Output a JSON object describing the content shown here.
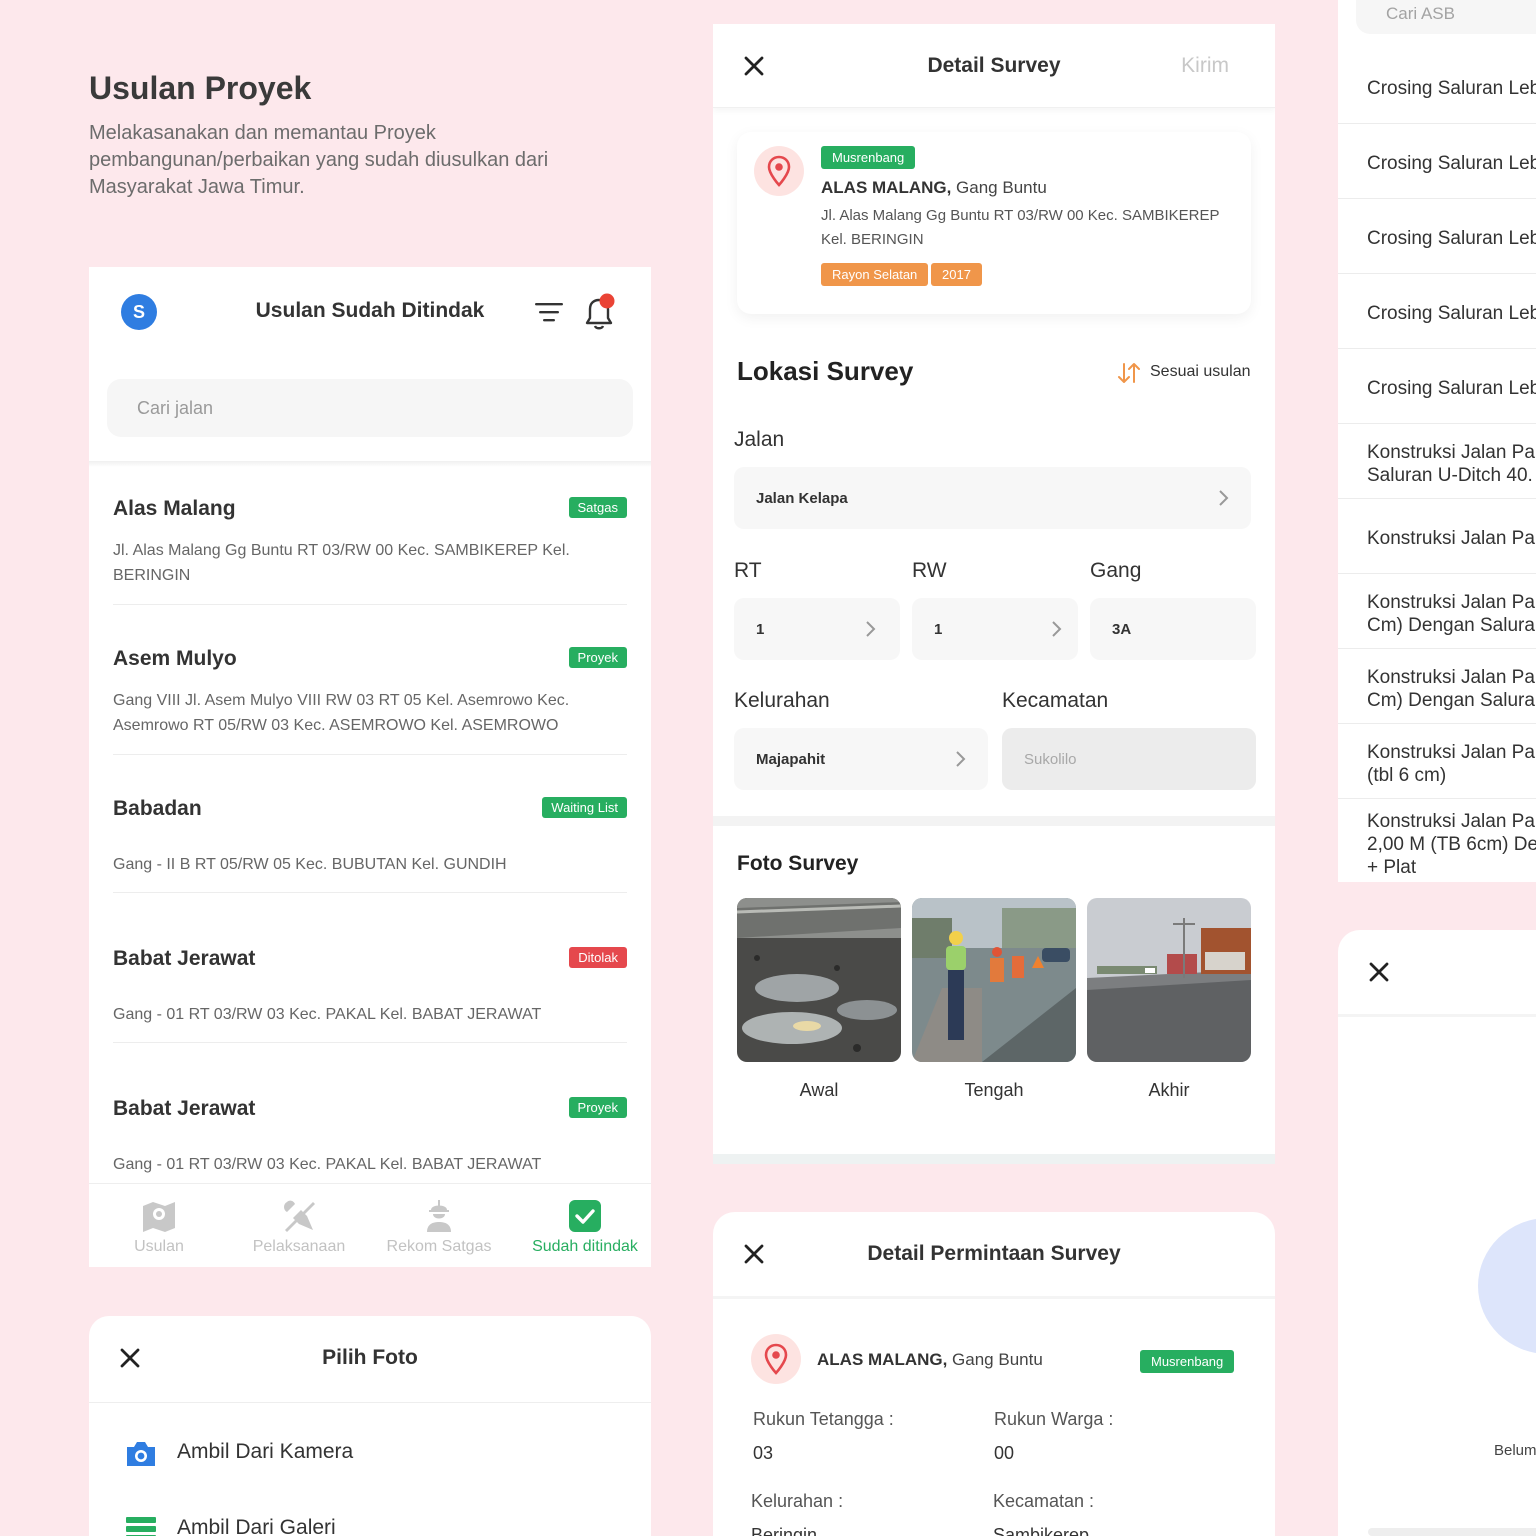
{
  "hero": {
    "title": "Usulan Proyek",
    "description": "Melakasanakan dan memantau Proyek pembangunan/perbaikan yang sudah diusulkan dari Masyarakat Jawa Timur."
  },
  "list_screen": {
    "avatar_letter": "S",
    "title": "Usulan Sudah Ditindak",
    "search_placeholder": "Cari jalan",
    "items": [
      {
        "name": "Alas Malang",
        "badge": "Satgas",
        "badge_color": "#27ae60",
        "address": "Jl. Alas Malang Gg Buntu RT 03/RW 00 Kec. SAMBIKEREP Kel. BERINGIN"
      },
      {
        "name": "Asem Mulyo",
        "badge": "Proyek",
        "badge_color": "#27ae60",
        "address": "Gang VIII Jl. Asem Mulyo VIII RW 03 RT 05 Kel. Asemrowo Kec. Asemrowo RT 05/RW 03 Kec. ASEMROWO Kel. ASEMROWO"
      },
      {
        "name": "Babadan",
        "badge": "Waiting List",
        "badge_color": "#27ae60",
        "address": "Gang - II B RT 05/RW 05 Kec. BUBUTAN Kel. GUNDIH"
      },
      {
        "name": "Babat Jerawat",
        "badge": "Ditolak",
        "badge_color": "#e5484d",
        "address": "Gang - 01 RT 03/RW 03 Kec. PAKAL Kel. BABAT JERAWAT"
      },
      {
        "name": "Babat Jerawat",
        "badge": "Proyek",
        "badge_color": "#27ae60",
        "address": "Gang - 01 RT 03/RW 03 Kec. PAKAL Kel. BABAT JERAWAT"
      }
    ],
    "nav": [
      {
        "label": "Usulan",
        "icon": "map-icon",
        "active": false
      },
      {
        "label": "Pelaksanaan",
        "icon": "tools-icon",
        "active": false
      },
      {
        "label": "Rekom Satgas",
        "icon": "worker-icon",
        "active": false
      },
      {
        "label": "Sudah ditindak",
        "icon": "check-icon",
        "active": true
      }
    ],
    "active_color": "#27ae60"
  },
  "photo_picker": {
    "title": "Pilih Foto",
    "options": [
      "Ambil Dari Kamera",
      "Ambil Dari Galeri"
    ]
  },
  "detail_survey": {
    "title": "Detail Survey",
    "send_label": "Kirim",
    "card": {
      "tag": "Musrenbang",
      "name_bold": "ALAS MALANG,",
      "name_rest": " Gang Buntu",
      "address": "Jl. Alas Malang Gg Buntu RT 03/RW 00 Kec. SAMBIKEREP Kel. BERINGIN",
      "tags": [
        "Rayon Selatan",
        "2017"
      ]
    },
    "location_title": "Lokasi Survey",
    "sort_label": "Sesuai usulan",
    "fields": {
      "jalan_label": "Jalan",
      "jalan_value": "Jalan Kelapa",
      "rt_label": "RT",
      "rt_value": "1",
      "rw_label": "RW",
      "rw_value": "1",
      "gang_label": "Gang",
      "gang_value": "3A",
      "kelurahan_label": "Kelurahan",
      "kelurahan_value": "Majapahit",
      "kecamatan_label": "Kecamatan",
      "kecamatan_value": "Sukolilo"
    },
    "photo_title": "Foto Survey",
    "photos": [
      "Awal",
      "Tengah",
      "Akhir"
    ]
  },
  "request_detail": {
    "title": "Detail Permintaan Survey",
    "name_bold": "ALAS MALANG,",
    "name_rest": " Gang Buntu",
    "tag": "Musrenbang",
    "rt_label": "Rukun Tetangga :",
    "rt_value": "03",
    "rw_label": "Rukun Warga :",
    "rw_value": "00",
    "kel_label": "Kelurahan :",
    "kel_value": "Beringin",
    "kec_label": "Kecamatan :",
    "kec_value": "Sambikerep"
  },
  "asb_list": {
    "search_placeholder": "Cari ASB",
    "items": [
      "Crosing Saluran Leb",
      "Crosing Saluran Leb",
      "Crosing Saluran Leb",
      "Crosing Saluran Leb",
      "Crosing Saluran Leb",
      "Konstruksi Jalan Pa\nSaluran U-Ditch 40.",
      "Konstruksi Jalan Pa",
      "Konstruksi Jalan Pa\nCm) Dengan Saluran",
      "Konstruksi Jalan Pa\nCm) Dengan Saluran",
      "Konstruksi Jalan Pa\n(tbl 6 cm)",
      "Konstruksi Jalan Pa\n2,00 M (TB 6cm) De\n+ Plat"
    ]
  },
  "empty_panel": {
    "message": "Belum"
  },
  "colors": {
    "background": "#fde8ec",
    "green": "#27ae60",
    "red": "#e5484d",
    "orange": "#f0964a",
    "blue": "#2f7de1"
  }
}
